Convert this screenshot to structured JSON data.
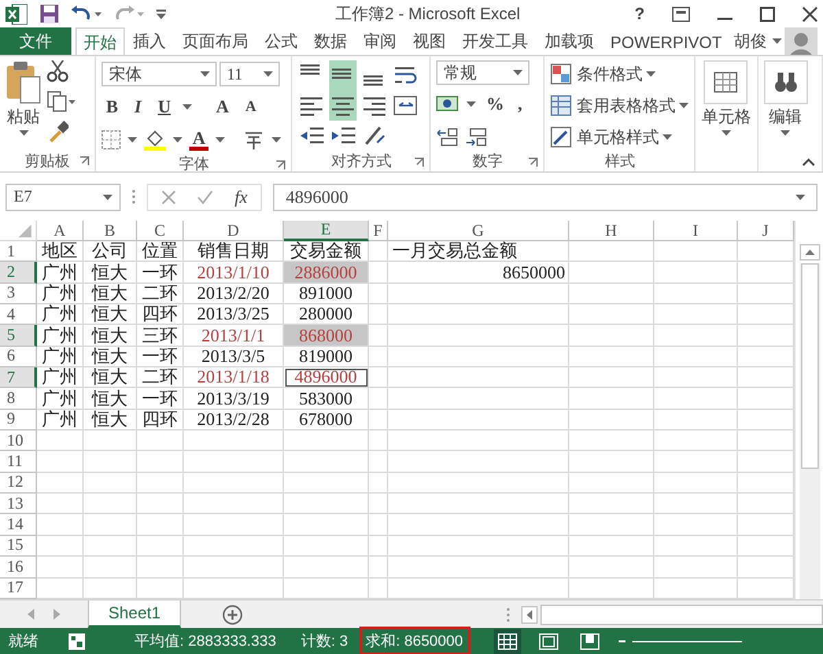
{
  "title_bar": {
    "title": "工作簿2 - Microsoft Excel",
    "help": "?"
  },
  "ribbon_tabs": [
    {
      "label": "文件",
      "kind": "file",
      "selected": false
    },
    {
      "label": "开始",
      "kind": "tab",
      "selected": true
    },
    {
      "label": "插入",
      "kind": "tab",
      "selected": false
    },
    {
      "label": "页面布局",
      "kind": "tab",
      "selected": false
    },
    {
      "label": "公式",
      "kind": "tab",
      "selected": false
    },
    {
      "label": "数据",
      "kind": "tab",
      "selected": false
    },
    {
      "label": "审阅",
      "kind": "tab",
      "selected": false
    },
    {
      "label": "视图",
      "kind": "tab",
      "selected": false
    },
    {
      "label": "开发工具",
      "kind": "tab",
      "selected": false
    },
    {
      "label": "加载项",
      "kind": "tab",
      "selected": false
    },
    {
      "label": "POWERPIVOT",
      "kind": "tab",
      "selected": false
    }
  ],
  "user": {
    "name": "胡俊"
  },
  "ribbon": {
    "clipboard": {
      "paste": "粘贴",
      "group_label": "剪贴板"
    },
    "font": {
      "font_name": "宋体",
      "font_size": "11",
      "bold": "B",
      "italic": "I",
      "underline": "U",
      "grow": "A",
      "shrink": "A",
      "font_color": "A",
      "group_label": "字体"
    },
    "alignment": {
      "buttons": [
        {
          "kind": "top",
          "selected": false
        },
        {
          "kind": "middle",
          "selected": true
        },
        {
          "kind": "bottom",
          "selected": false
        },
        {
          "kind": "wrap",
          "selected": false
        },
        {
          "kind": "left",
          "selected": false
        },
        {
          "kind": "center",
          "selected": true
        },
        {
          "kind": "right",
          "selected": false
        },
        {
          "kind": "merge",
          "selected": false
        },
        {
          "kind": "outdent",
          "selected": false
        },
        {
          "kind": "indent",
          "selected": false
        },
        {
          "kind": "orientation",
          "selected": false
        }
      ],
      "group_label": "对齐方式"
    },
    "number": {
      "format": "常规",
      "percent": "%",
      "comma": ",",
      "group_label": "数字"
    },
    "styles": {
      "items": [
        "条件格式",
        "套用表格格式",
        "单元格样式"
      ],
      "group_label": "样式"
    },
    "cells": {
      "label": "单元格"
    },
    "editing": {
      "label": "编辑"
    }
  },
  "formula_bar": {
    "name_box": "E7",
    "fx": "fx",
    "value": "4896000"
  },
  "sheet": {
    "columns": [
      {
        "label": "A",
        "selected": false
      },
      {
        "label": "B",
        "selected": false
      },
      {
        "label": "C",
        "selected": false
      },
      {
        "label": "D",
        "selected": false
      },
      {
        "label": "E",
        "selected": true
      },
      {
        "label": "F",
        "selected": false
      },
      {
        "label": "G",
        "selected": false
      },
      {
        "label": "H",
        "selected": false
      },
      {
        "label": "I",
        "selected": false
      },
      {
        "label": "J",
        "selected": false
      }
    ],
    "rows": [
      {
        "number": "1",
        "selected": false,
        "cells": [
          {
            "text": "地区",
            "selected": false,
            "active": false
          },
          {
            "text": "公司",
            "selected": false,
            "active": false
          },
          {
            "text": "位置",
            "selected": false,
            "active": false
          },
          {
            "text": "销售日期",
            "selected": false,
            "active": false
          },
          {
            "text": "交易金额",
            "selected": false,
            "active": false
          },
          {
            "selected": false,
            "active": false
          },
          {
            "text": "一月交易总金额",
            "selected": false,
            "active": false
          }
        ]
      },
      {
        "number": "2",
        "selected": true,
        "cells": [
          {
            "text": "广州",
            "selected": false,
            "active": false
          },
          {
            "text": "恒大",
            "selected": false,
            "active": false
          },
          {
            "text": "一环",
            "selected": false,
            "active": false
          },
          {
            "text": "2013/1/10",
            "selected": false,
            "active": false,
            "color": "#b5413f"
          },
          {
            "text": "2886000",
            "selected": true,
            "active": false,
            "color": "#b5413f"
          },
          {
            "selected": false,
            "active": false
          },
          {
            "text": "8650000",
            "kind": "formula",
            "selected": false,
            "active": false
          }
        ]
      },
      {
        "number": "3",
        "selected": false,
        "cells": [
          {
            "text": "广州",
            "selected": false,
            "active": false
          },
          {
            "text": "恒大",
            "selected": false,
            "active": false
          },
          {
            "text": "二环",
            "selected": false,
            "active": false
          },
          {
            "text": "2013/2/20",
            "selected": false,
            "active": false
          },
          {
            "text": "891000",
            "selected": false,
            "active": false
          }
        ]
      },
      {
        "number": "4",
        "selected": false,
        "cells": [
          {
            "text": "广州",
            "selected": false,
            "active": false
          },
          {
            "text": "恒大",
            "selected": false,
            "active": false
          },
          {
            "text": "四环",
            "selected": false,
            "active": false
          },
          {
            "text": "2013/3/25",
            "selected": false,
            "active": false
          },
          {
            "text": "280000",
            "selected": false,
            "active": false
          }
        ]
      },
      {
        "number": "5",
        "selected": true,
        "cells": [
          {
            "text": "广州",
            "selected": false,
            "active": false
          },
          {
            "text": "恒大",
            "selected": false,
            "active": false
          },
          {
            "text": "三环",
            "selected": false,
            "active": false
          },
          {
            "text": "2013/1/1",
            "selected": false,
            "active": false,
            "color": "#b5413f"
          },
          {
            "text": "868000",
            "selected": true,
            "active": false,
            "color": "#b5413f"
          }
        ]
      },
      {
        "number": "6",
        "selected": false,
        "cells": [
          {
            "text": "广州",
            "selected": false,
            "active": false
          },
          {
            "text": "恒大",
            "selected": false,
            "active": false
          },
          {
            "text": "一环",
            "selected": false,
            "active": false
          },
          {
            "text": "2013/3/5",
            "selected": false,
            "active": false
          },
          {
            "text": "819000",
            "selected": false,
            "active": false
          }
        ]
      },
      {
        "number": "7",
        "selected": true,
        "cells": [
          {
            "text": "广州",
            "selected": false,
            "active": false
          },
          {
            "text": "恒大",
            "selected": false,
            "active": false
          },
          {
            "text": "二环",
            "selected": false,
            "active": false
          },
          {
            "text": "2013/1/18",
            "selected": false,
            "active": false,
            "color": "#b5413f"
          },
          {
            "text": "4896000",
            "selected": true,
            "active": true,
            "color": "#b5413f"
          }
        ]
      },
      {
        "number": "8",
        "selected": false,
        "cells": [
          {
            "text": "广州",
            "selected": false,
            "active": false
          },
          {
            "text": "恒大",
            "selected": false,
            "active": false
          },
          {
            "text": "一环",
            "selected": false,
            "active": false
          },
          {
            "text": "2013/3/19",
            "selected": false,
            "active": false
          },
          {
            "text": "583000",
            "selected": false,
            "active": false
          }
        ]
      },
      {
        "number": "9",
        "selected": false,
        "cells": [
          {
            "text": "广州",
            "selected": false,
            "active": false
          },
          {
            "text": "恒大",
            "selected": false,
            "active": false
          },
          {
            "text": "四环",
            "selected": false,
            "active": false
          },
          {
            "text": "2013/2/28",
            "selected": false,
            "active": false
          },
          {
            "text": "678000",
            "selected": false,
            "active": false
          }
        ]
      },
      {
        "number": "10",
        "selected": false
      },
      {
        "number": "11",
        "selected": false
      },
      {
        "number": "12",
        "selected": false
      },
      {
        "number": "13",
        "selected": false
      },
      {
        "number": "14",
        "selected": false
      },
      {
        "number": "15",
        "selected": false
      },
      {
        "number": "16",
        "selected": false
      },
      {
        "number": "17",
        "selected": false
      }
    ]
  },
  "sheet_tabs": [
    {
      "label": "Sheet1",
      "selected": true
    }
  ],
  "status_bar": {
    "mode": "就绪",
    "average": "平均值: 2883333.333",
    "count": "计数: 3",
    "sum": "求和: 8650000",
    "sum_highlighted": true,
    "views": [
      {
        "kind": "normal",
        "selected": true
      },
      {
        "kind": "page_layout",
        "selected": false
      },
      {
        "kind": "page_break",
        "selected": false
      }
    ]
  }
}
